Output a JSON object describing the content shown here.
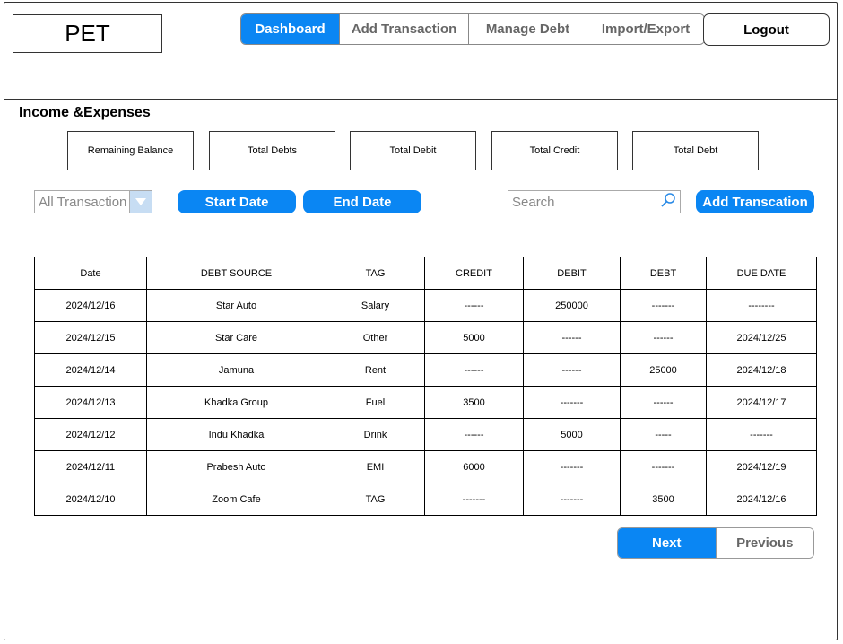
{
  "app": {
    "logo": "PET"
  },
  "nav": {
    "items": [
      {
        "label": "Dashboard"
      },
      {
        "label": "Add Transaction"
      },
      {
        "label": "Manage Debt"
      },
      {
        "label": "Import/Export"
      }
    ],
    "active_index": 0,
    "logout_label": "Logout"
  },
  "section": {
    "title": "Income &Expenses"
  },
  "summary": {
    "cards": [
      {
        "label": "Remaining Balance"
      },
      {
        "label": "Total Debts"
      },
      {
        "label": "Total Debit"
      },
      {
        "label": "Total Credit"
      },
      {
        "label": "Total Debt"
      }
    ]
  },
  "filters": {
    "type_select": "All Transaction",
    "start_date_label": "Start Date",
    "end_date_label": "End Date",
    "search_placeholder": "Search",
    "add_button_label": "Add Transcation"
  },
  "table": {
    "columns": [
      "Date",
      "DEBT SOURCE",
      "TAG",
      "CREDIT",
      "DEBIT",
      "DEBT",
      "DUE DATE"
    ],
    "rows": [
      [
        "2024/12/16",
        "Star Auto",
        "Salary",
        "------",
        "250000",
        "-------",
        "--------"
      ],
      [
        "2024/12/15",
        "Star Care",
        "Other",
        "5000",
        "------",
        "------",
        "2024/12/25"
      ],
      [
        "2024/12/14",
        "Jamuna",
        "Rent",
        "------",
        "------",
        "25000",
        "2024/12/18"
      ],
      [
        "2024/12/13",
        "Khadka Group",
        "Fuel",
        "3500",
        "-------",
        "------",
        "2024/12/17"
      ],
      [
        "2024/12/12",
        "Indu Khadka",
        "Drink",
        "------",
        "5000",
        "-----",
        "-------"
      ],
      [
        "2024/12/11",
        "Prabesh Auto",
        "EMI",
        "6000",
        "-------",
        "-------",
        "2024/12/19"
      ],
      [
        "2024/12/10",
        "Zoom Cafe",
        "TAG",
        "-------",
        "-------",
        "3500",
        "2024/12/16"
      ]
    ]
  },
  "pagination": {
    "next_label": "Next",
    "previous_label": "Previous"
  },
  "colors": {
    "accent": "#0a86f3",
    "select_arrow_bg": "#c7ddf3"
  }
}
